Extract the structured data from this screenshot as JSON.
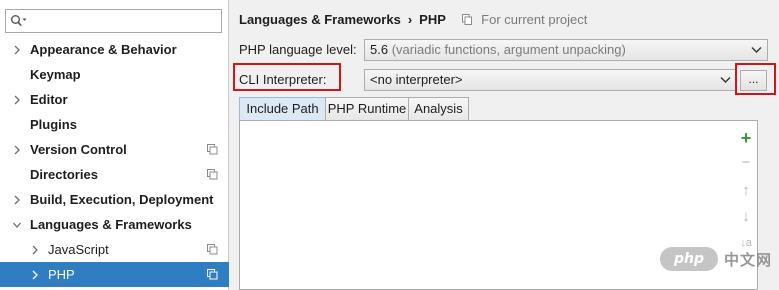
{
  "sidebar": {
    "search": {
      "value": "",
      "placeholder": ""
    },
    "items": [
      {
        "label": "Appearance & Behavior",
        "has_arrow": true,
        "arrow": "right",
        "child": false,
        "project_icon": false,
        "selected": false
      },
      {
        "label": "Keymap",
        "has_arrow": false,
        "arrow": "",
        "child": false,
        "project_icon": false,
        "selected": false
      },
      {
        "label": "Editor",
        "has_arrow": true,
        "arrow": "right",
        "child": false,
        "project_icon": false,
        "selected": false
      },
      {
        "label": "Plugins",
        "has_arrow": false,
        "arrow": "",
        "child": false,
        "project_icon": false,
        "selected": false
      },
      {
        "label": "Version Control",
        "has_arrow": true,
        "arrow": "right",
        "child": false,
        "project_icon": true,
        "selected": false
      },
      {
        "label": "Directories",
        "has_arrow": false,
        "arrow": "",
        "child": false,
        "project_icon": true,
        "selected": false
      },
      {
        "label": "Build, Execution, Deployment",
        "has_arrow": true,
        "arrow": "right",
        "child": false,
        "project_icon": false,
        "selected": false
      },
      {
        "label": "Languages & Frameworks",
        "has_arrow": true,
        "arrow": "down",
        "child": false,
        "project_icon": false,
        "selected": false
      },
      {
        "label": "JavaScript",
        "has_arrow": true,
        "arrow": "right",
        "child": true,
        "project_icon": true,
        "selected": false
      },
      {
        "label": "PHP",
        "has_arrow": true,
        "arrow": "right",
        "child": true,
        "project_icon": true,
        "selected": true
      }
    ]
  },
  "header": {
    "crumb_parent": "Languages & Frameworks",
    "crumb_separator": "›",
    "crumb_current": "PHP",
    "scope_hint": "For current project"
  },
  "form": {
    "php_level_label": "PHP language level:",
    "php_level_value": "5.6",
    "php_level_hint": "(variadic functions, argument unpacking)",
    "cli_label": "CLI Interpreter:",
    "cli_value": "<no interpreter>",
    "more_button_label": "..."
  },
  "tabs": [
    {
      "label": "Include Path",
      "active": true
    },
    {
      "label": "PHP Runtime",
      "active": false
    },
    {
      "label": "Analysis",
      "active": false
    }
  ],
  "toolstrip": {
    "add_symbol": "+",
    "remove_symbol": "−",
    "up_symbol": "↑",
    "down_symbol": "↓",
    "sort_symbol": "↓a"
  },
  "watermark": {
    "badge": "php",
    "text": "中文网"
  },
  "colors": {
    "selection": "#2f7ec2",
    "highlight_box": "#d0161b",
    "active_tab": "#dbe8f5",
    "add_icon": "#3b9a3b"
  }
}
